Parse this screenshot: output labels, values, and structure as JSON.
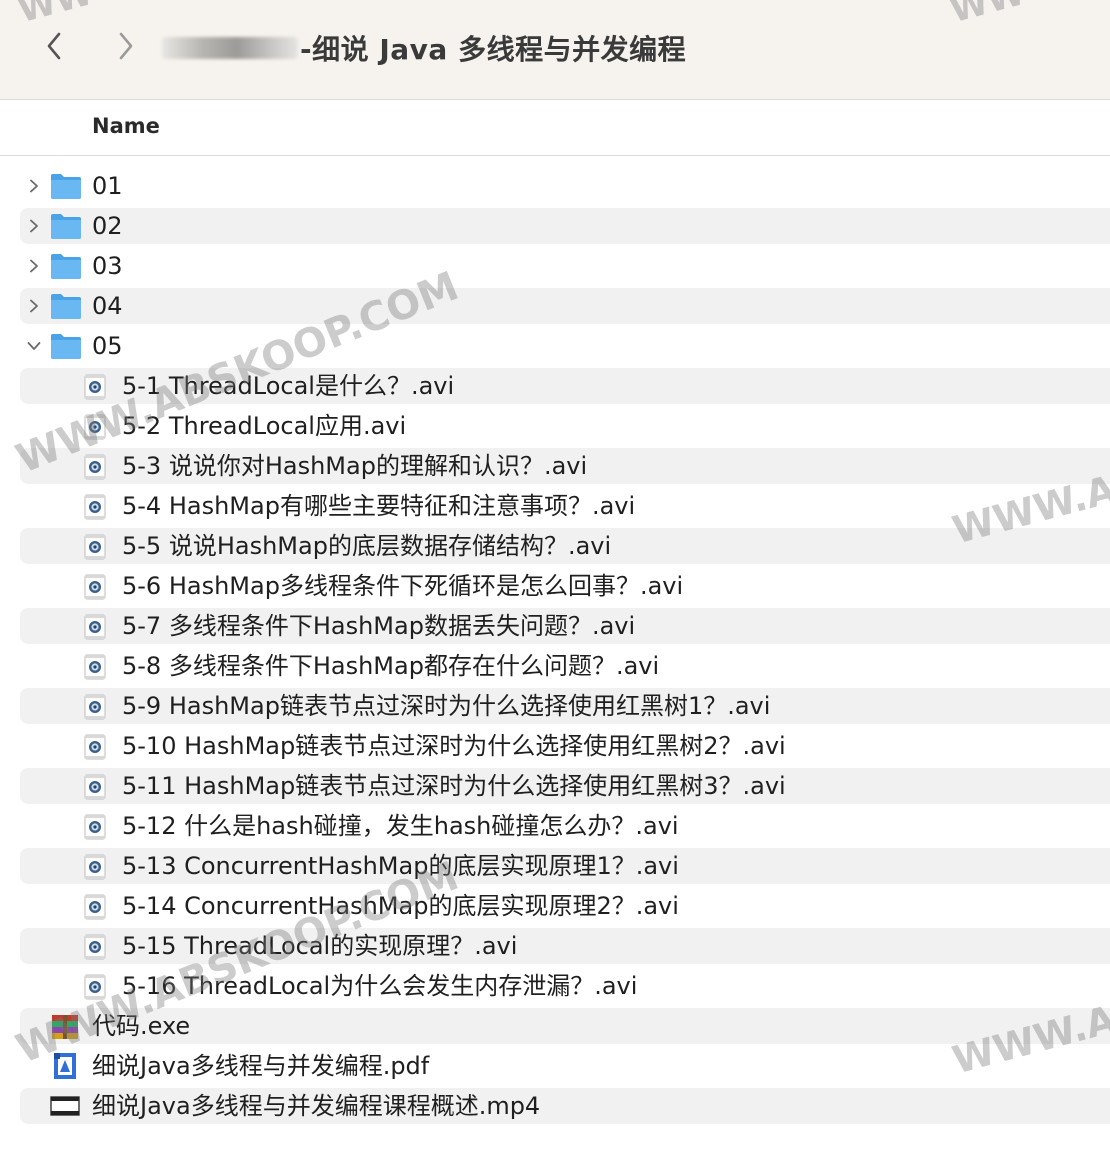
{
  "toolbar": {
    "back_icon": "chevron-left-icon",
    "forward_icon": "chevron-right-icon",
    "title": "-细说 Java 多线程与并发编程"
  },
  "column_header": {
    "name": "Name"
  },
  "folders": [
    {
      "label": "01",
      "expanded": false
    },
    {
      "label": "02",
      "expanded": false
    },
    {
      "label": "03",
      "expanded": false
    },
    {
      "label": "04",
      "expanded": false
    },
    {
      "label": "05",
      "expanded": true
    }
  ],
  "folder_05_children": [
    "5-1 ThreadLocal是什么？.avi",
    "5-2 ThreadLocal应用.avi",
    "5-3 说说你对HashMap的理解和认识？.avi",
    "5-4 HashMap有哪些主要特征和注意事项？.avi",
    "5-5 说说HashMap的底层数据存储结构？.avi",
    "5-6 HashMap多线程条件下死循环是怎么回事？.avi",
    "5-7 多线程条件下HashMap数据丢失问题？.avi",
    "5-8 多线程条件下HashMap都存在什么问题？.avi",
    "5-9 HashMap链表节点过深时为什么选择使用红黑树1？.avi",
    "5-10 HashMap链表节点过深时为什么选择使用红黑树2？.avi",
    "5-11 HashMap链表节点过深时为什么选择使用红黑树3？.avi",
    "5-12 什么是hash碰撞，发生hash碰撞怎么办？.avi",
    "5-13 ConcurrentHashMap的底层实现原理1？.avi",
    "5-14 ConcurrentHashMap的底层实现原理2？.avi",
    "5-15 ThreadLocal的实现原理？.avi",
    "5-16 ThreadLocal为什么会发生内存泄漏？.avi"
  ],
  "root_files": [
    {
      "label": "代码.exe",
      "icon": "archive-icon"
    },
    {
      "label": "细说Java多线程与并发编程.pdf",
      "icon": "pdf-document-icon"
    },
    {
      "label": "细说Java多线程与并发编程课程概述.mp4",
      "icon": "video-file-icon"
    }
  ],
  "watermarks": {
    "diagonal_1": "WWW.ABSKOOP.COM",
    "diagonal_2": "WWW.ABSKOOP.COM",
    "corner": "WWW.A"
  },
  "colors": {
    "folder_blue": "#5ab0ee",
    "stripe": "#f1f1f1",
    "toolbar_bg": "#f6f3ef"
  }
}
